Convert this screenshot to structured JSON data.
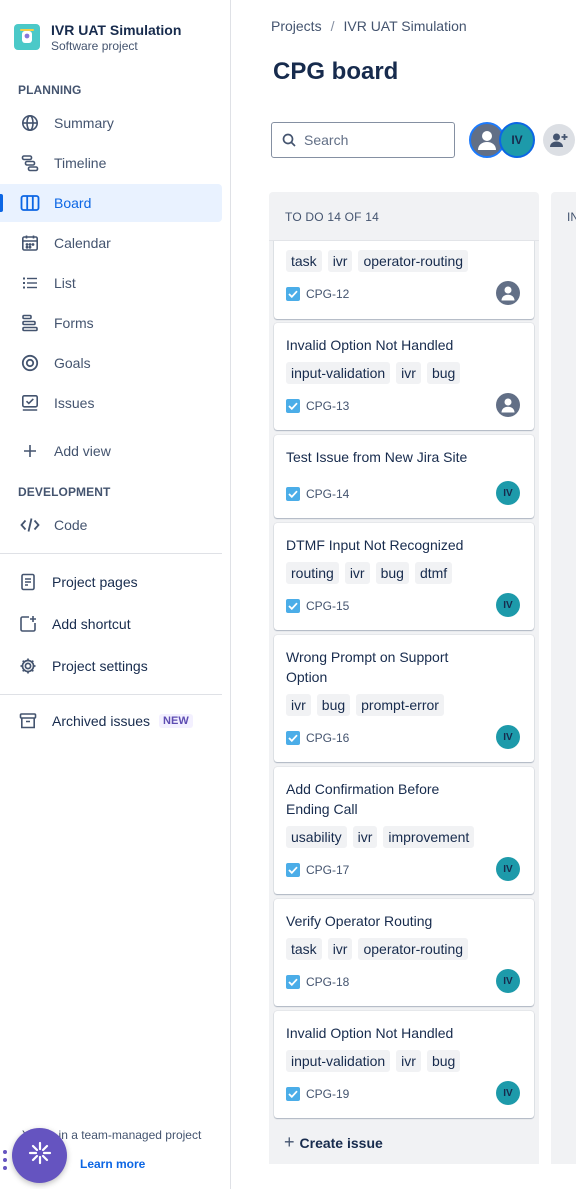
{
  "project": {
    "name": "IVR UAT Simulation",
    "type": "Software project"
  },
  "sidebar": {
    "planning_heading": "PLANNING",
    "planning_items": [
      {
        "label": "Summary",
        "icon": "globe-icon"
      },
      {
        "label": "Timeline",
        "icon": "timeline-icon"
      },
      {
        "label": "Board",
        "icon": "board-icon",
        "active": true
      },
      {
        "label": "Calendar",
        "icon": "calendar-icon"
      },
      {
        "label": "List",
        "icon": "list-icon"
      },
      {
        "label": "Forms",
        "icon": "forms-icon"
      },
      {
        "label": "Goals",
        "icon": "goals-icon"
      },
      {
        "label": "Issues",
        "icon": "issues-icon"
      }
    ],
    "add_view": "Add view",
    "development_heading": "DEVELOPMENT",
    "code": "Code",
    "project_pages": "Project pages",
    "add_shortcut": "Add shortcut",
    "project_settings": "Project settings",
    "archived_issues": "Archived issues",
    "new_badge": "NEW",
    "footer_text": "You're in a team-managed project",
    "learn_more": "Learn more"
  },
  "breadcrumb": {
    "projects": "Projects",
    "sep": "/",
    "current": "IVR UAT Simulation"
  },
  "board": {
    "title": "CPG board",
    "search_placeholder": "Search",
    "avatar_initials": "IV",
    "columns": [
      {
        "title": "TO DO 14 OF 14"
      },
      {
        "title": "IN"
      }
    ],
    "create_issue": "Create issue"
  },
  "cards": [
    {
      "title": "",
      "labels": [
        "task",
        "ivr",
        "operator-routing"
      ],
      "key": "CPG-12",
      "assignee": "unassigned"
    },
    {
      "title": "Invalid Option Not Handled",
      "labels": [
        "input-validation",
        "ivr",
        "bug"
      ],
      "key": "CPG-13",
      "assignee": "unassigned"
    },
    {
      "title": "Test Issue from New Jira Site",
      "labels": [],
      "key": "CPG-14",
      "assignee": "IV"
    },
    {
      "title": "DTMF Input Not Recognized",
      "labels": [
        "routing",
        "ivr",
        "bug",
        "dtmf"
      ],
      "key": "CPG-15",
      "assignee": "IV"
    },
    {
      "title": "Wrong Prompt on Support Option",
      "labels": [
        "ivr",
        "bug",
        "prompt-error"
      ],
      "key": "CPG-16",
      "assignee": "IV"
    },
    {
      "title": "Add Confirmation Before Ending Call",
      "labels": [
        "usability",
        "ivr",
        "improvement"
      ],
      "key": "CPG-17",
      "assignee": "IV"
    },
    {
      "title": "Verify Operator Routing",
      "labels": [
        "task",
        "ivr",
        "operator-routing"
      ],
      "key": "CPG-18",
      "assignee": "IV"
    },
    {
      "title": "Invalid Option Not Handled",
      "labels": [
        "input-validation",
        "ivr",
        "bug"
      ],
      "key": "CPG-19",
      "assignee": "IV"
    }
  ],
  "colors": {
    "accent": "#0c66e4",
    "column_bg": "#f1f2f4",
    "avatar_teal": "#1d9aaa",
    "fab": "#6554c0"
  }
}
